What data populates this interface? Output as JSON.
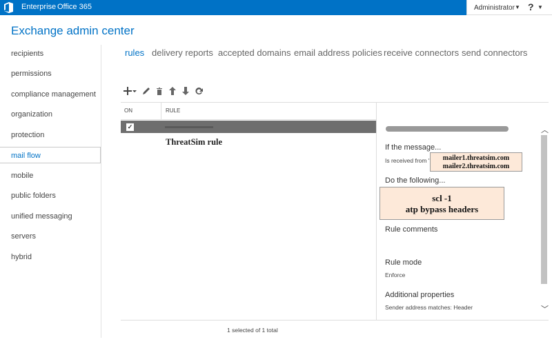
{
  "topbar": {
    "links": [
      "Enterprise",
      "Office 365"
    ],
    "user": "Administrator",
    "help": "?"
  },
  "app": {
    "title": "Exchange admin center"
  },
  "nav": {
    "items": [
      "recipients",
      "permissions",
      "compliance management",
      "organization",
      "protection",
      "mail flow",
      "mobile",
      "public folders",
      "unified messaging",
      "servers",
      "hybrid"
    ],
    "active": "mail flow"
  },
  "tabs": [
    "rules",
    "delivery reports",
    "accepted domains",
    "email address policies",
    "receive connectors",
    "send connectors"
  ],
  "list": {
    "columns": {
      "on": "ON",
      "rule": "RULE"
    },
    "annotation": "ThreatSim rule",
    "status": "1 selected of 1 total"
  },
  "details": {
    "if_heading": "If the message...",
    "if_value": "Is received from '",
    "callout_ips": [
      "mailer1.threatsim.com",
      "mailer2.threatsim.com"
    ],
    "do_heading": "Do the following...",
    "callout_actions": [
      "scl -1",
      "atp bypass headers"
    ],
    "comments_heading": "Rule comments",
    "mode_heading": "Rule mode",
    "mode_value": "Enforce",
    "props_heading": "Additional properties",
    "props_value": "Sender address matches: Header"
  },
  "colors": {
    "accent": "#0072c6",
    "callout": "#fde9d9",
    "selected_row": "#6e6e6e"
  }
}
